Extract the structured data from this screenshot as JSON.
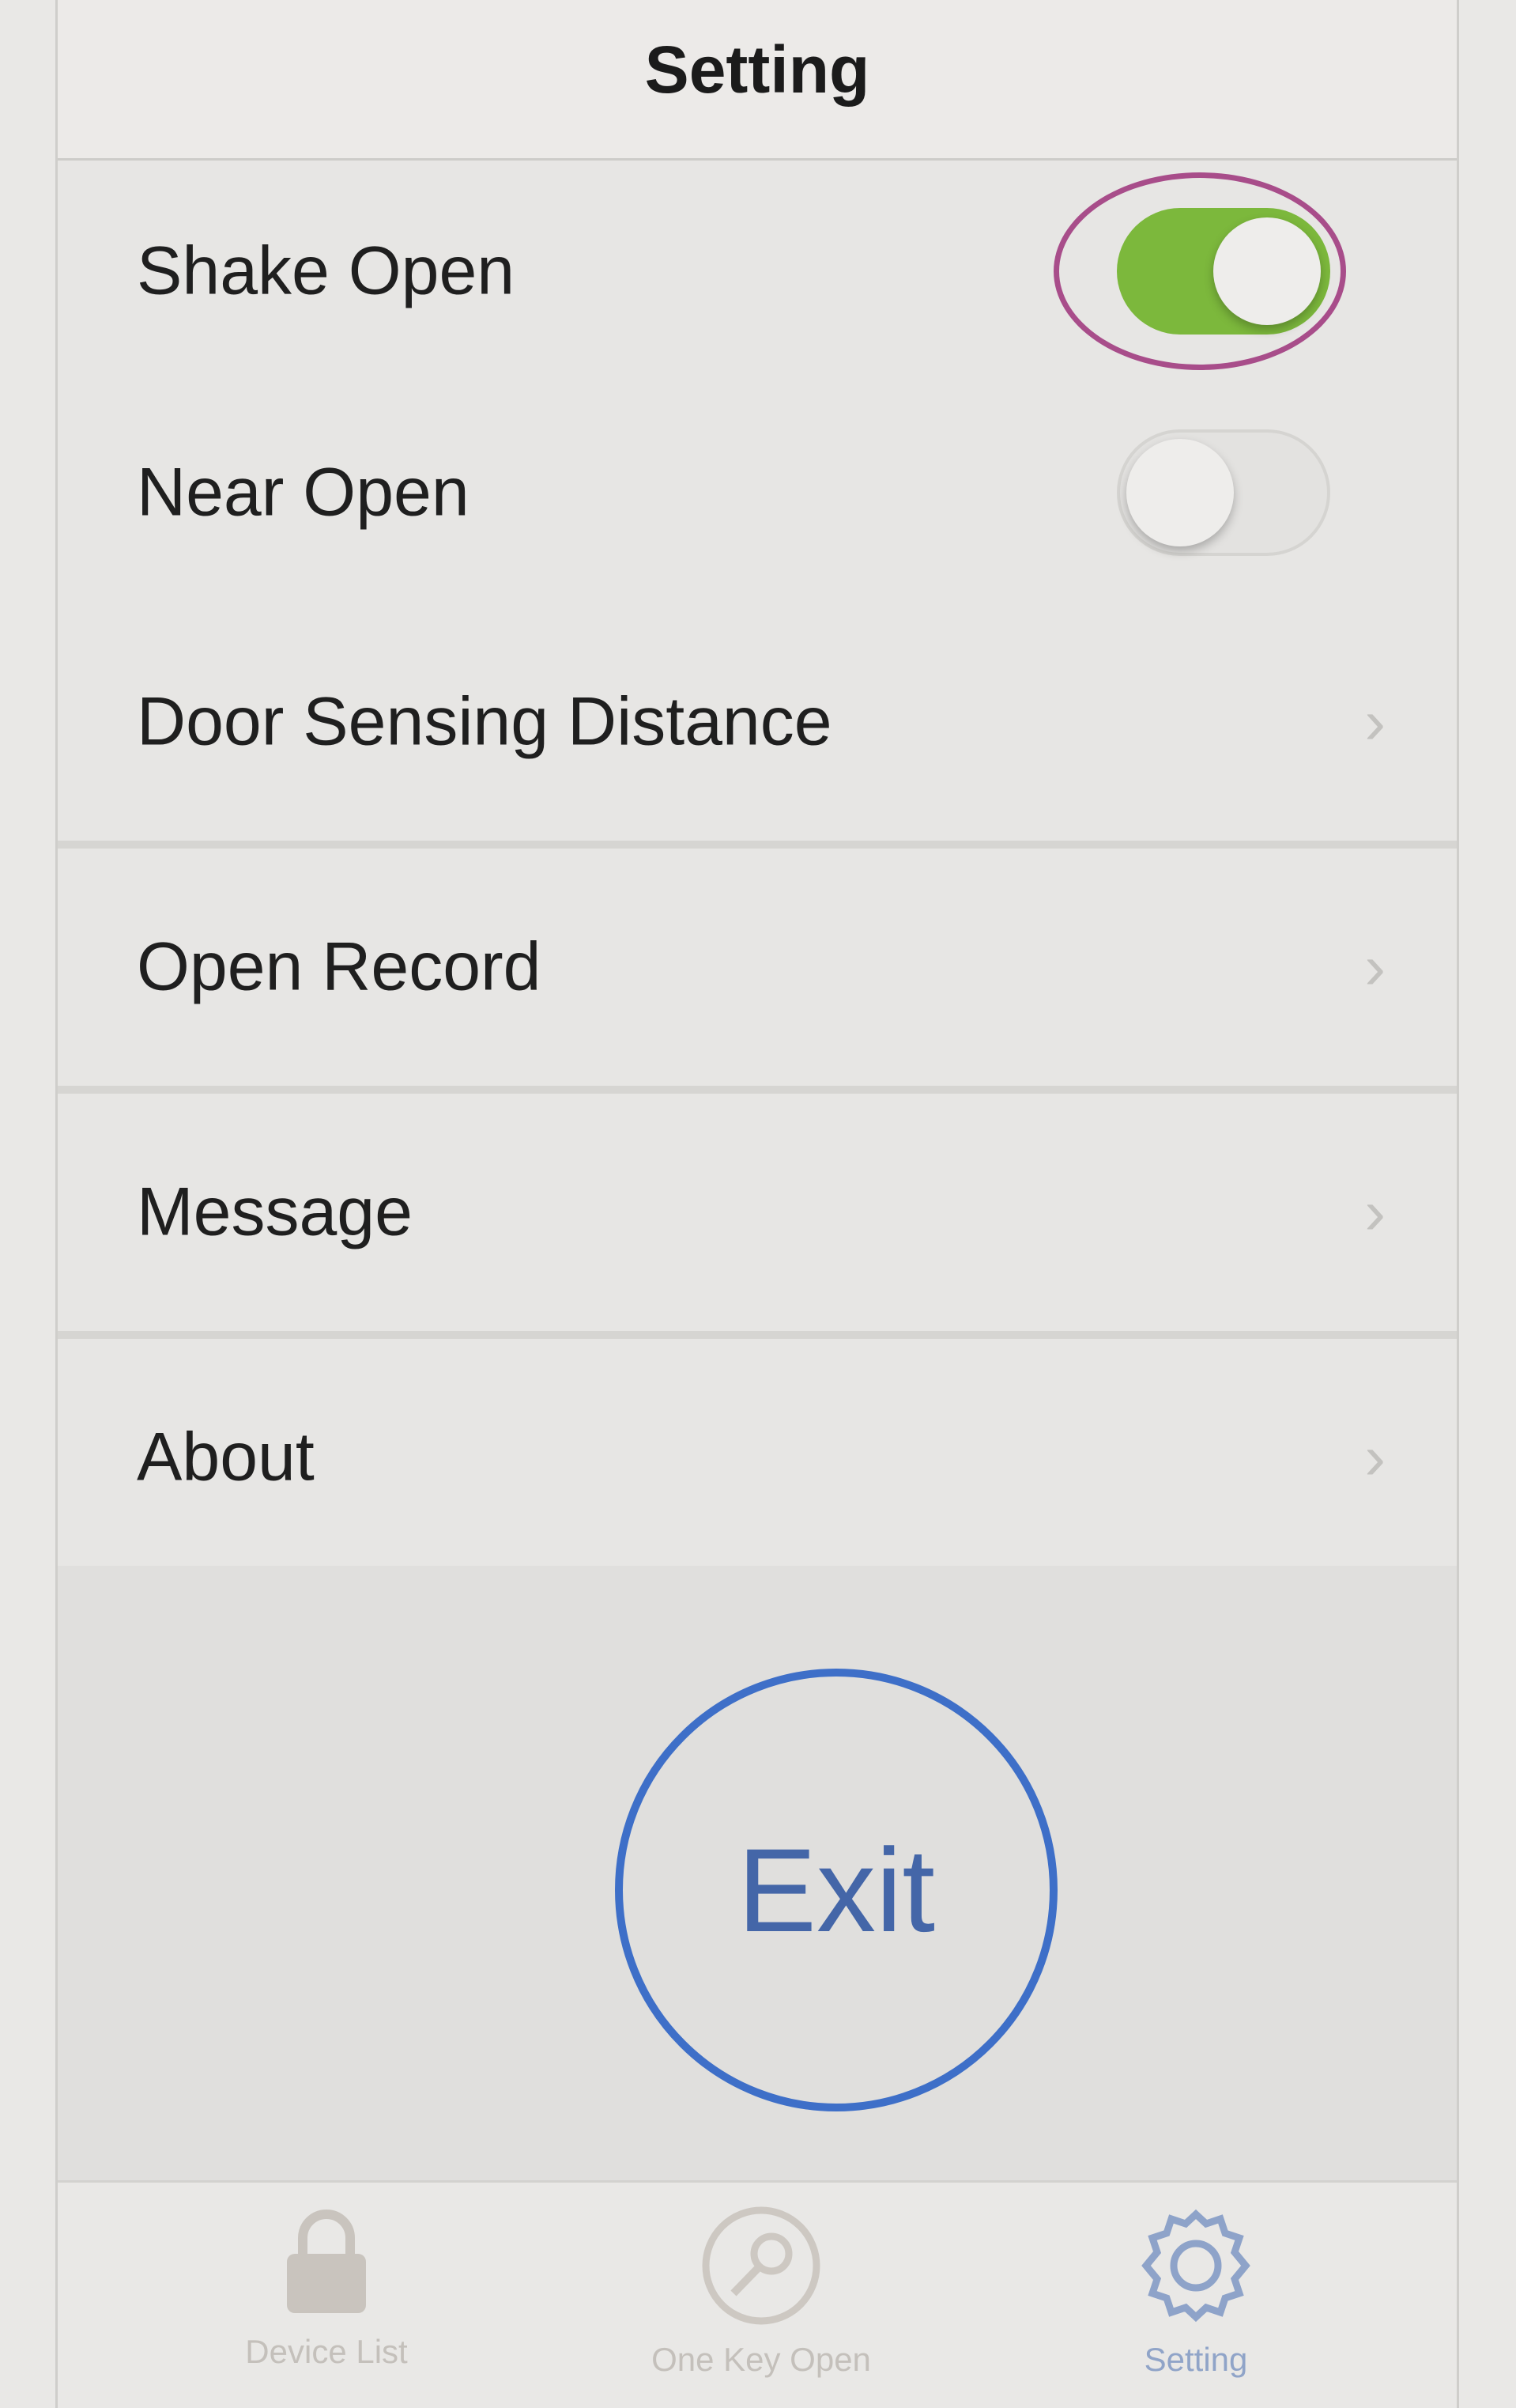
{
  "nav": {
    "title": "Setting"
  },
  "settings": {
    "shake_open": {
      "label": "Shake Open",
      "enabled": true
    },
    "near_open": {
      "label": "Near Open",
      "enabled": false
    },
    "door_sensing_distance": {
      "label": "Door Sensing Distance",
      "chevron": "›"
    },
    "open_record": {
      "label": "Open Record",
      "chevron": "›"
    },
    "message": {
      "label": "Message",
      "chevron": "›"
    },
    "about": {
      "label": "About",
      "chevron": "›"
    }
  },
  "exit_button": {
    "label": "Exit"
  },
  "tab_bar": {
    "tabs": [
      {
        "label": "Device List",
        "icon": "lock-icon",
        "active": false
      },
      {
        "label": "One Key Open",
        "icon": "key-icon",
        "active": false
      },
      {
        "label": "Setting",
        "icon": "gear-icon",
        "active": true
      }
    ]
  },
  "colors": {
    "toggle_on": "#7cb83c",
    "annotation_ellipse": "#a84d8a",
    "exit_circle": "#3e6fc8",
    "active_tab": "#90a4c8"
  }
}
